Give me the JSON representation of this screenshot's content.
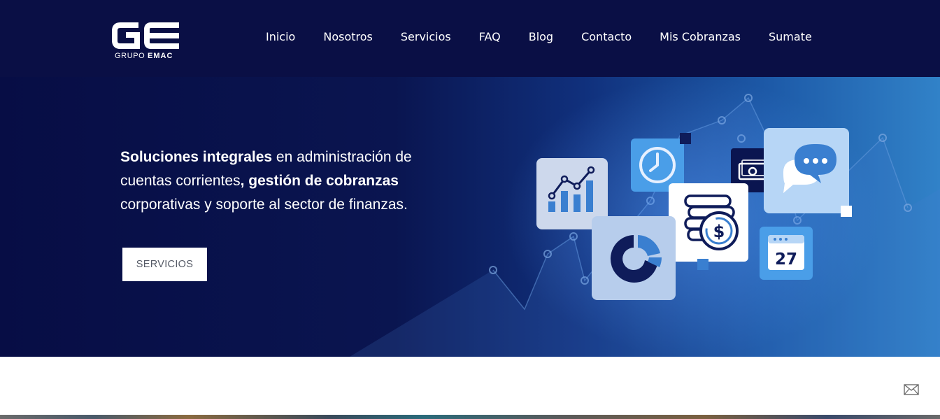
{
  "brand": {
    "logo_letters": "GE",
    "logo_prefix": "GRUPO",
    "logo_suffix": "EMAC"
  },
  "nav": {
    "items": [
      {
        "label": "Inicio"
      },
      {
        "label": "Nosotros"
      },
      {
        "label": "Servicios"
      },
      {
        "label": "FAQ"
      },
      {
        "label": "Blog"
      },
      {
        "label": "Contacto"
      },
      {
        "label": "Mis Cobranzas"
      },
      {
        "label": "Sumate"
      }
    ]
  },
  "hero": {
    "part1_bold": "Soluciones integrales",
    "part2": " en administración de cuentas corrientes",
    "part3_bold": ", gestión de cobranzas",
    "part4": " corporativas y soporte al sector de finanzas.",
    "button_label": "SERVICIOS",
    "calendar_day": "27",
    "coin_symbol": "$"
  },
  "icons": {
    "chart": "bar-chart-icon",
    "clock": "clock-icon",
    "money": "banknotes-icon",
    "chat": "chat-bubbles-icon",
    "coins": "coins-icon",
    "pie": "pie-chart-icon",
    "calendar": "calendar-icon",
    "mail": "mail-icon"
  },
  "colors": {
    "header_bg": "#0a0f45",
    "hero_dark": "#070d45",
    "hero_light": "#3182c8",
    "button_bg": "#ffffff",
    "button_text": "#555a66"
  }
}
